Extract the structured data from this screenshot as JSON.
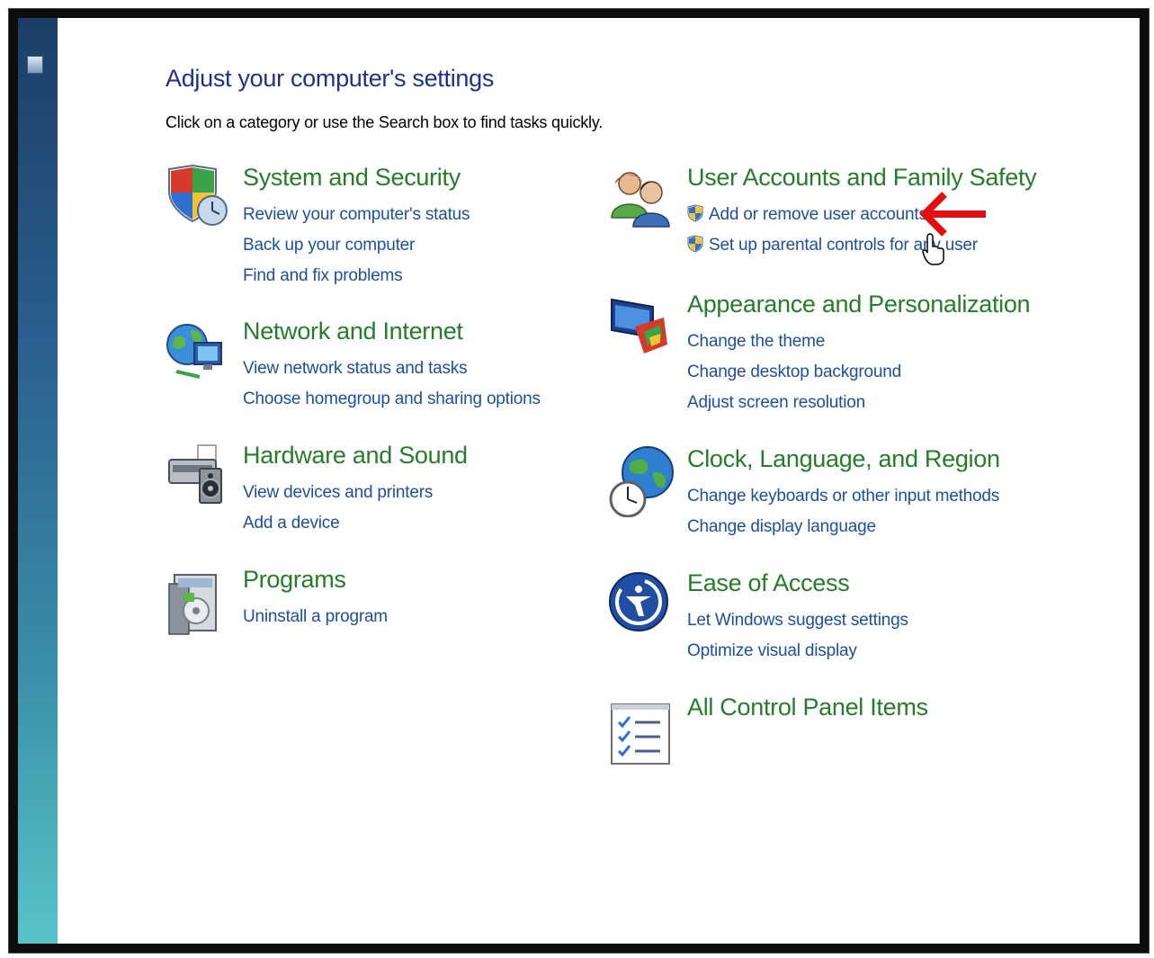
{
  "header": {
    "title": "Adjust your computer's settings",
    "subtitle": "Click on a category or use the Search box to find tasks quickly."
  },
  "categories": {
    "system": {
      "title": "System and Security",
      "links": [
        "Review your computer's status",
        "Back up your computer",
        "Find and fix problems"
      ]
    },
    "network": {
      "title": "Network and Internet",
      "links": [
        "View network status and tasks",
        "Choose homegroup and sharing options"
      ]
    },
    "hardware": {
      "title": "Hardware and Sound",
      "links": [
        "View devices and printers",
        "Add a device"
      ]
    },
    "programs": {
      "title": "Programs",
      "links": [
        "Uninstall a program"
      ]
    },
    "users": {
      "title": "User Accounts and Family Safety",
      "links": [
        "Add or remove user accounts",
        "Set up parental controls for any user"
      ]
    },
    "appearance": {
      "title": "Appearance and Personalization",
      "links": [
        "Change the theme",
        "Change desktop background",
        "Adjust screen resolution"
      ]
    },
    "clock": {
      "title": "Clock, Language, and Region",
      "links": [
        "Change keyboards or other input methods",
        "Change display language"
      ]
    },
    "ease": {
      "title": "Ease of Access",
      "links": [
        "Let Windows suggest settings",
        "Optimize visual display"
      ]
    },
    "all": {
      "title": "All Control Panel Items"
    }
  },
  "colors": {
    "title_blue": "#1e3287",
    "category_green": "#267c2a",
    "link_blue": "#1e4e9e",
    "annotation_arrow": "#e01010"
  },
  "icons": {
    "system": "shield-clock-icon",
    "network": "globe-network-icon",
    "hardware": "printer-speaker-icon",
    "programs": "programs-box-icon",
    "users": "users-icon",
    "appearance": "monitor-palette-icon",
    "clock": "globe-clock-icon",
    "ease": "ease-of-access-icon",
    "all": "checklist-icon",
    "uac": "uac-shield-icon",
    "arrow": "red-arrow-icon",
    "cursor": "hand-cursor-icon"
  }
}
